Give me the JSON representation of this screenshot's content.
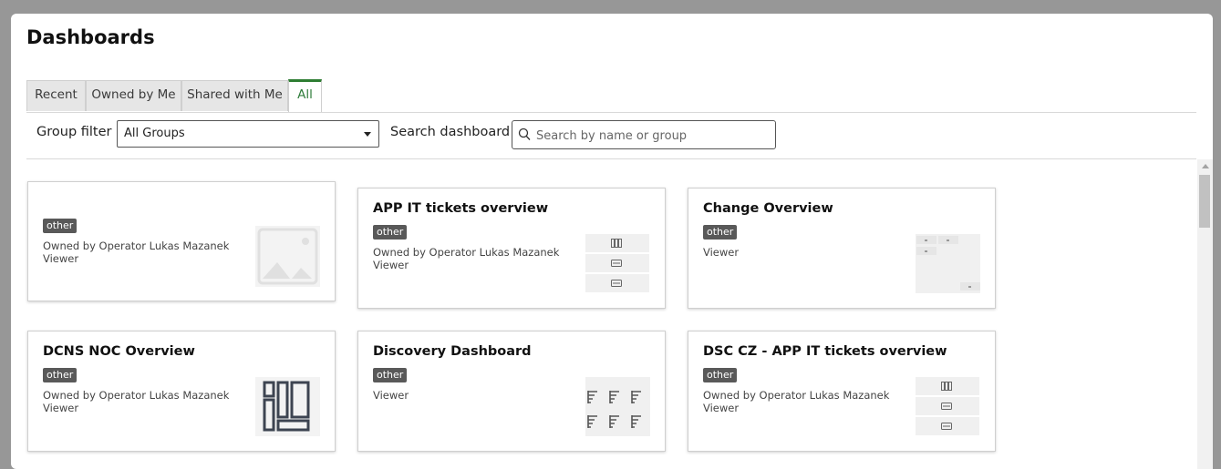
{
  "page": {
    "title": "Dashboards"
  },
  "tabs": [
    {
      "label": "Recent",
      "active": false
    },
    {
      "label": "Owned by Me",
      "active": false
    },
    {
      "label": "Shared with Me",
      "active": false
    },
    {
      "label": "All",
      "active": true
    }
  ],
  "filters": {
    "group_label": "Group filter",
    "group_value": "All Groups",
    "search_label": "Search dashboard",
    "search_placeholder": "Search by name or group",
    "search_value": ""
  },
  "cards": [
    {
      "title": "",
      "badge": "other",
      "owner": "Owned by Operator Lukas Mazanek",
      "role": "Viewer",
      "thumbnail": "image-placeholder-icon"
    },
    {
      "title": "APP IT tickets overview",
      "badge": "other",
      "owner": "Owned by Operator Lukas Mazanek",
      "role": "Viewer",
      "thumbnail": "widget-list-thumbnail"
    },
    {
      "title": "Change Overview",
      "badge": "other",
      "owner": "",
      "role": "Viewer",
      "thumbnail": "layout-grid-thumbnail"
    },
    {
      "title": "DCNS NOC Overview",
      "badge": "other",
      "owner": "Owned by Operator Lukas Mazanek",
      "role": "Viewer",
      "thumbnail": "dashboard-layout-icon"
    },
    {
      "title": "Discovery Dashboard",
      "badge": "other",
      "owner": "",
      "role": "Viewer",
      "thumbnail": "bar-chart-grid-thumbnail"
    },
    {
      "title": "DSC CZ - APP IT tickets overview",
      "badge": "other",
      "owner": "Owned by Operator Lukas Mazanek",
      "role": "Viewer",
      "thumbnail": "widget-list-thumbnail"
    }
  ],
  "colors": {
    "active_tab": "#2e7d32",
    "badge": "#595959",
    "backdrop": "#979797"
  }
}
